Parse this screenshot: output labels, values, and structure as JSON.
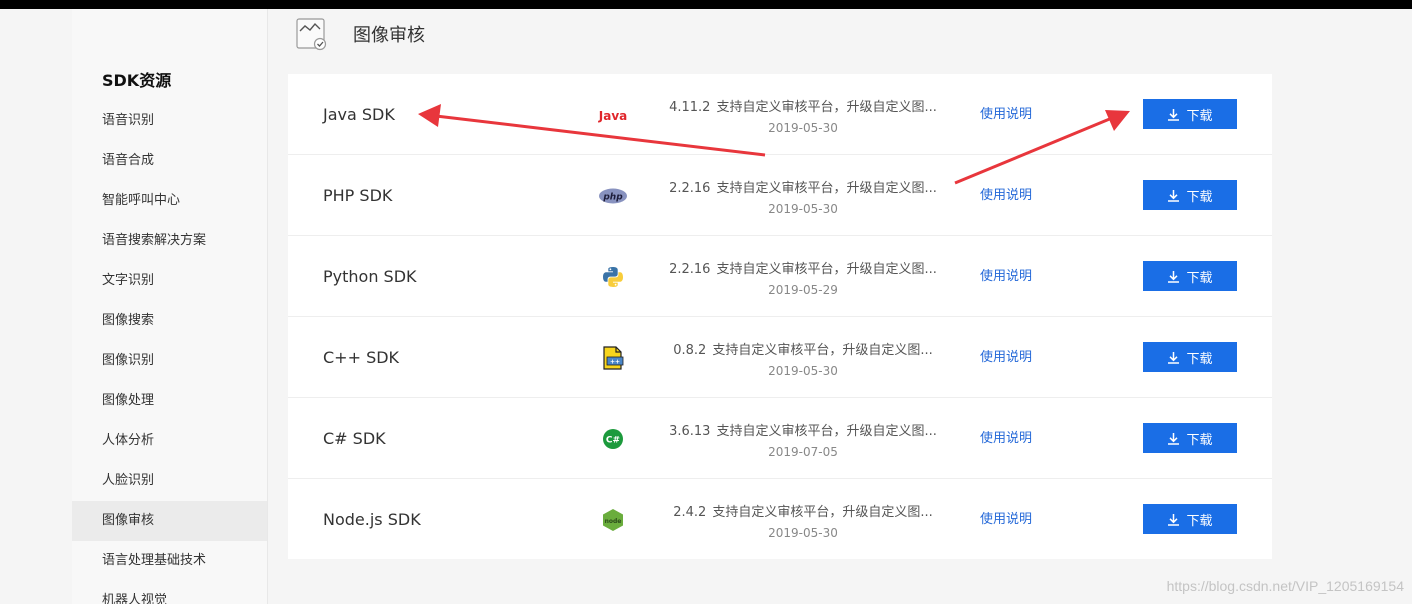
{
  "sidebar": {
    "title": "SDK资源",
    "items": [
      {
        "label": "语音识别"
      },
      {
        "label": "语音合成"
      },
      {
        "label": "智能呼叫中心"
      },
      {
        "label": "语音搜索解决方案"
      },
      {
        "label": "文字识别"
      },
      {
        "label": "图像搜索"
      },
      {
        "label": "图像识别"
      },
      {
        "label": "图像处理"
      },
      {
        "label": "人体分析"
      },
      {
        "label": "人脸识别"
      },
      {
        "label": "图像审核",
        "active": true
      },
      {
        "label": "语言处理基础技术"
      },
      {
        "label": "机器人视觉"
      }
    ]
  },
  "header": {
    "title": "图像审核",
    "icon": "image-audit-icon"
  },
  "sdks": [
    {
      "name": "Java SDK",
      "logo": "java-logo",
      "logo_text": "Java",
      "version": "4.11.2",
      "desc": "支持自定义审核平台，升级自定义图...",
      "date": "2019-05-30",
      "guide": "使用说明",
      "download": "下载"
    },
    {
      "name": "PHP SDK",
      "logo": "php-logo",
      "logo_text": "php",
      "version": "2.2.16",
      "desc": "支持自定义审核平台，升级自定义图...",
      "date": "2019-05-30",
      "guide": "使用说明",
      "download": "下载"
    },
    {
      "name": "Python SDK",
      "logo": "python-logo",
      "version": "2.2.16",
      "desc": "支持自定义审核平台，升级自定义图...",
      "date": "2019-05-29",
      "guide": "使用说明",
      "download": "下载"
    },
    {
      "name": "C++ SDK",
      "logo": "cpp-logo",
      "version": "0.8.2",
      "desc": "支持自定义审核平台，升级自定义图...",
      "date": "2019-05-30",
      "guide": "使用说明",
      "download": "下载"
    },
    {
      "name": "C# SDK",
      "logo": "csharp-logo",
      "logo_text": "C#",
      "version": "3.6.13",
      "desc": "支持自定义审核平台，升级自定义图...",
      "date": "2019-07-05",
      "guide": "使用说明",
      "download": "下载"
    },
    {
      "name": "Node.js SDK",
      "logo": "nodejs-logo",
      "logo_text": "node",
      "version": "2.4.2",
      "desc": "支持自定义审核平台，升级自定义图...",
      "date": "2019-05-30",
      "guide": "使用说明",
      "download": "下载"
    }
  ],
  "colors": {
    "accent": "#1a6ee6",
    "link": "#2468d8",
    "annotation_arrow": "#e8363c"
  },
  "watermark": "https://blog.csdn.net/VIP_1205169154"
}
